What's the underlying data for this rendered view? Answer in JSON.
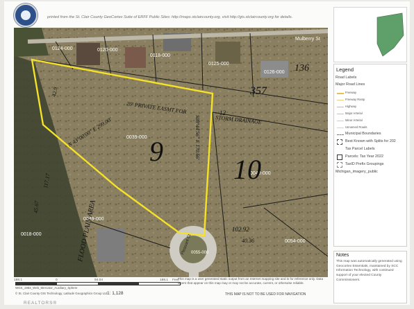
{
  "header": {
    "source_text": "printed from the St. Clair County GeoCortex Suite of ERFF Public Sites: http://maps.stclaircounty.org, visit http://gis.stclaircounty.org for details."
  },
  "map": {
    "street_label": "Mulberry St",
    "parcel_labels": {
      "p1": "0124-000",
      "p2": "0120-000",
      "p3": "0118-000",
      "p4": "0125-000",
      "p5": "0126-000",
      "p6": "0039-000",
      "p7": "0040-000",
      "p8": "0054-000",
      "p9": "0055-000",
      "p10": "0049-000",
      "p11": "0018-000"
    },
    "lot_9": "9",
    "lot_10": "10",
    "handwriting": {
      "private_easement": "20' PRIVATE EASMT FOR",
      "storm_drainage": "STORM DRAINAGE",
      "flood_plain": "FLOOD PLAIN AREA",
      "easement_number": "12"
    },
    "dimensions": {
      "d1": "N 43°00'00\" E 299.00'",
      "d2": "S08°44'56\" E 170.66'",
      "d3": "102.92",
      "d4": "40.36",
      "d5": "117.17",
      "d6": "45.67",
      "d7": "42.9",
      "d8": "357",
      "d9": "136"
    },
    "cul_de_sac_label": "Pleasant Ct"
  },
  "inset": {},
  "legend": {
    "title": "Legend",
    "items": [
      {
        "label": "Road Labels"
      },
      {
        "label": "Major Road Lines"
      },
      {
        "label": "Freeway",
        "sub": true,
        "color": "#e6c04b"
      },
      {
        "label": "Freeway Ramp",
        "sub": true,
        "color": "#e9cf7c"
      },
      {
        "label": "Highway",
        "sub": true,
        "color": "#b8b8b8"
      },
      {
        "label": "Major Arterial",
        "sub": true,
        "color": "#c1c1c1"
      },
      {
        "label": "Minor Arterial",
        "sub": true,
        "color": "#cccccc"
      },
      {
        "label": "Unnamed Roads",
        "sub": true,
        "color": "#d3d3d3"
      },
      {
        "label": "Municipal Boundaries"
      },
      {
        "label": "Best Known with Splits for 202"
      },
      {
        "label": "Tax Parcel Labels"
      },
      {
        "label": "Parcels: Tax Year 2022"
      },
      {
        "label": "TaxID Prefix Groupings"
      },
      {
        "label": "Michigan_imagery_public"
      }
    ]
  },
  "notes": {
    "title": "Notes",
    "body": "This map was automatically generated using Geocortex Essentials, maintained by SCC Information Technology, with continued support of your elected County Commissioners."
  },
  "scale": {
    "ticks": [
      "188.1",
      "0",
      "94.04",
      "188.1",
      "Feet"
    ],
    "ratio": "1: 1,128",
    "coord": "WGS_1984_Web_Mercator_Auxiliary_Sphere",
    "credit": "© St. Clair County GIS Technology, Latitude Geographics Group Ltd."
  },
  "disclaimer": "This map is a user generated static output from an Internet mapping site and is for reference only. Data layers that appear on this map may or may not be accurate, current, or otherwise reliable.",
  "nav_warning": "THIS MAP IS NOT TO BE USED FOR NAVIGATION",
  "watermark": {
    "realtors": "REALTORS®"
  },
  "colors": {
    "parcel_highlight": "#f4e12a",
    "parcel_lines": "#1a1a1a",
    "sheet": "#fbfbf9"
  }
}
